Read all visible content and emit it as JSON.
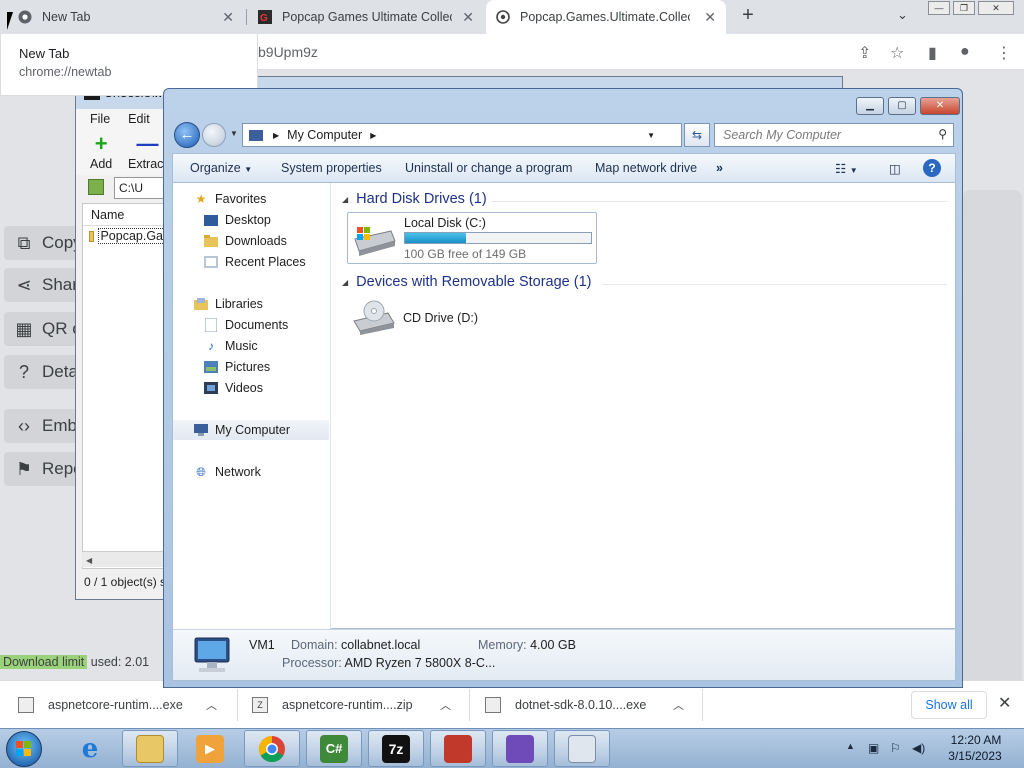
{
  "browser": {
    "tabs": [
      {
        "title": "New Tab",
        "icon": "chrome-icon"
      },
      {
        "title": "Popcap Games Ultimate Collectio",
        "icon": "gk-favicon-icon"
      },
      {
        "title": "Popcap.Games.Ultimate.Collectio",
        "icon": "chrome-spinner-icon"
      }
    ],
    "new_tab": "+",
    "url_fragment": "b9Upm9z",
    "hover_card": {
      "title": "New Tab",
      "url": "chrome://newtab"
    },
    "side_menu": [
      {
        "label": "Copy",
        "icon": "copy-icon"
      },
      {
        "label": "Shar",
        "icon": "share-icon"
      },
      {
        "label": "QR c",
        "icon": "qr-code-icon"
      },
      {
        "label": "Deta",
        "icon": "question-icon"
      },
      {
        "label": "Emb",
        "icon": "embed-icon"
      },
      {
        "label": "Repo",
        "icon": "flag-icon"
      }
    ],
    "download_limit": {
      "highlight": "Download limit",
      "rest": " used: 2.01"
    }
  },
  "downloads": {
    "items": [
      {
        "name": "aspnetcore-runtim....exe"
      },
      {
        "name": "aspnetcore-runtim....zip"
      },
      {
        "name": "dotnet-sdk-8.0.10....exe"
      }
    ],
    "show_all": "Show all"
  },
  "sevenzip": {
    "title": "C:\\Users\\w",
    "menu": [
      "File",
      "Edit",
      "V"
    ],
    "toolbar": [
      {
        "label": "Add",
        "glyph": "+"
      },
      {
        "label": "Extract",
        "glyph": "—"
      }
    ],
    "path": "C:\\U",
    "column": "Name",
    "row": "Popcap.Ga",
    "status": "0 / 1 object(s) s"
  },
  "explorer": {
    "address": "My Computer",
    "search_placeholder": "Search My Computer",
    "commands": [
      "Organize",
      "System properties",
      "Uninstall or change a program",
      "Map network drive",
      "»"
    ],
    "nav": {
      "favorites": {
        "label": "Favorites",
        "items": [
          "Desktop",
          "Downloads",
          "Recent Places"
        ]
      },
      "libraries": {
        "label": "Libraries",
        "items": [
          "Documents",
          "Music",
          "Pictures",
          "Videos"
        ]
      },
      "computer": "My Computer",
      "network": "Network"
    },
    "groups": {
      "hdd": {
        "header": "Hard Disk Drives (1)",
        "drive": {
          "name": "Local Disk (C:)",
          "free": "100 GB free of 149 GB",
          "used_fraction": 0.33
        }
      },
      "removable": {
        "header": "Devices with Removable Storage (1)",
        "drive": {
          "name": "CD Drive (D:)"
        }
      }
    },
    "details": {
      "name": "VM1",
      "domain_label": "Domain:",
      "domain": "collabnet.local",
      "memory_label": "Memory:",
      "memory": "4.00 GB",
      "processor_label": "Processor:",
      "processor": "AMD Ryzen 7 5800X 8-C..."
    }
  },
  "taskbar": {
    "apps": [
      {
        "name": "ie",
        "glyph": "e"
      },
      {
        "name": "explorer",
        "glyph": ""
      },
      {
        "name": "media",
        "glyph": "▶"
      },
      {
        "name": "chrome",
        "glyph": ""
      },
      {
        "name": "csharp",
        "glyph": "C#"
      },
      {
        "name": "7zip",
        "glyph": "7z"
      },
      {
        "name": "toolbox",
        "glyph": ""
      },
      {
        "name": "visual-studio",
        "glyph": ""
      },
      {
        "name": "keyboard",
        "glyph": ""
      }
    ],
    "time": "12:20 AM",
    "date": "3/15/2023"
  },
  "colors": {
    "accent": "#1a73e8",
    "explorer_frame": "#bcd2ea",
    "disk_bar": "#1a8fc6"
  }
}
